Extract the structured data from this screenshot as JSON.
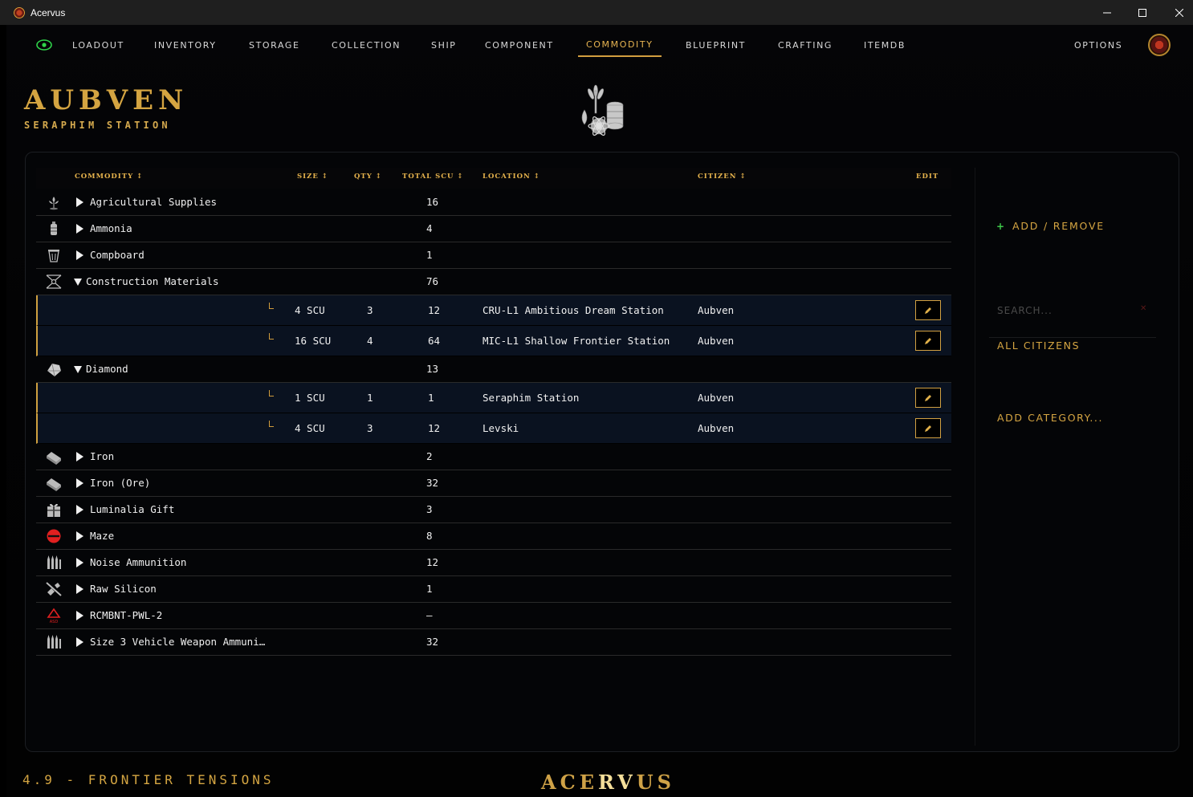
{
  "window": {
    "title": "Acervus"
  },
  "nav": {
    "items": [
      "LOADOUT",
      "INVENTORY",
      "STORAGE",
      "COLLECTION",
      "SHIP",
      "COMPONENT",
      "COMMODITY",
      "BLUEPRINT",
      "CRAFTING",
      "ITEMDB"
    ],
    "active": "COMMODITY",
    "options": "OPTIONS"
  },
  "station": {
    "name": "AUBVEN",
    "subtitle": "SERAPHIM STATION"
  },
  "table": {
    "headers": {
      "commodity": "COMMODITY ↕",
      "size": "SIZE ↕",
      "qty": "QTY ↕",
      "total_scu": "TOTAL SCU ↕",
      "location": "LOCATION ↕",
      "citizen": "CITIZEN ↕",
      "edit": "EDIT"
    },
    "rows": [
      {
        "kind": "cat",
        "icon": "plant-icon",
        "expanded": false,
        "name": "Agricultural Supplies",
        "total": "16"
      },
      {
        "kind": "cat",
        "icon": "canister-icon",
        "expanded": false,
        "name": "Ammonia",
        "total": "4"
      },
      {
        "kind": "cat",
        "icon": "bin-icon",
        "expanded": false,
        "name": "Compboard",
        "total": "1"
      },
      {
        "kind": "cat",
        "icon": "lattice-icon",
        "expanded": true,
        "name": "Construction Materials",
        "total": "76"
      },
      {
        "kind": "sub",
        "size": "4 SCU",
        "qty": "3",
        "total": "12",
        "location": "CRU-L1 Ambitious Dream Station",
        "citizen": "Aubven"
      },
      {
        "kind": "sub",
        "size": "16 SCU",
        "qty": "4",
        "total": "64",
        "location": "MIC-L1 Shallow Frontier Station",
        "citizen": "Aubven"
      },
      {
        "kind": "cat",
        "icon": "diamond-icon",
        "expanded": true,
        "name": "Diamond",
        "total": "13"
      },
      {
        "kind": "sub",
        "size": "1 SCU",
        "qty": "1",
        "total": "1",
        "location": "Seraphim Station",
        "citizen": "Aubven"
      },
      {
        "kind": "sub",
        "size": "4 SCU",
        "qty": "3",
        "total": "12",
        "location": "Levski",
        "citizen": "Aubven"
      },
      {
        "kind": "cat",
        "icon": "ingot-icon",
        "expanded": false,
        "name": "Iron",
        "total": "2"
      },
      {
        "kind": "cat",
        "icon": "ingot-icon",
        "expanded": false,
        "name": "Iron (Ore)",
        "total": "32"
      },
      {
        "kind": "cat",
        "icon": "gift-icon",
        "expanded": false,
        "name": "Luminalia Gift",
        "total": "3"
      },
      {
        "kind": "cat",
        "icon": "no-entry-icon",
        "expanded": false,
        "name": "Maze",
        "total": "8"
      },
      {
        "kind": "cat",
        "icon": "ammo-icon",
        "expanded": false,
        "name": "Noise Ammunition",
        "total": "12"
      },
      {
        "kind": "cat",
        "icon": "silicon-icon",
        "expanded": false,
        "name": "Raw Silicon",
        "total": "1"
      },
      {
        "kind": "cat",
        "icon": "asd-logo-icon",
        "expanded": false,
        "name": "RCMBNT-PWL-2",
        "total": "–"
      },
      {
        "kind": "cat",
        "icon": "ammo-icon",
        "expanded": false,
        "name": "Size 3 Vehicle Weapon Ammuni…",
        "total": "32"
      }
    ]
  },
  "sidebar": {
    "add_remove": "ADD / REMOVE",
    "search_placeholder": "SEARCH...",
    "all_citizens": "ALL CITIZENS",
    "add_category": "ADD CATEGORY..."
  },
  "footer": {
    "version": "4.9 - FRONTIER TENSIONS",
    "brand_a": "ACE",
    "brand_b": "RV",
    "brand_c": "US"
  },
  "colors": {
    "accent": "#d4a441",
    "active_nav": "#e7b451",
    "sub_row_bg": "#0a1220",
    "plus_green": "#3ec94a"
  }
}
